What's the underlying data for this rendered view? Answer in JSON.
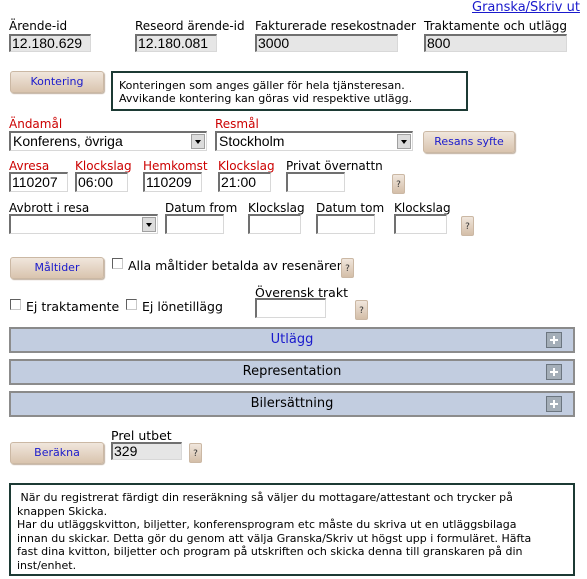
{
  "header": {
    "print_link": "Granska/Skriv ut",
    "fields": [
      {
        "label": "Ärende-id",
        "value": "12.180.629"
      },
      {
        "label": "Reseord ärende-id",
        "value": "12.180.081"
      },
      {
        "label": "Fakturerade resekostnader",
        "value": "3000"
      },
      {
        "label": "Traktamente och utlägg",
        "value": "800"
      }
    ]
  },
  "kontering": {
    "button_label": "Kontering",
    "note_line1": "Konteringen som anges gäller för hela tjänsteresan.",
    "note_line2": "Avvikande kontering kan göras vid respektive utlägg."
  },
  "purpose": {
    "andamal_label": "Ändamål",
    "andamal_value": "Konferens, övriga",
    "resmal_label": "Resmål",
    "resmal_value": "Stockholm",
    "syfte_button": "Resans syfte"
  },
  "dates": {
    "avresa_label": "Avresa",
    "avresa_value": "110207",
    "klockslag1_label": "Klockslag",
    "klockslag1_value": "06:00",
    "hemkomst_label": "Hemkomst",
    "hemkomst_value": "110209",
    "klockslag2_label": "Klockslag",
    "klockslag2_value": "21:00",
    "privat_label": "Privat övernattn",
    "privat_value": ""
  },
  "interruption": {
    "avbrott_label": "Avbrott i resa",
    "avbrott_value": "",
    "datum_from_label": "Datum from",
    "klockslag_from_label": "Klockslag",
    "datum_tom_label": "Datum tom",
    "klockslag_tom_label": "Klockslag"
  },
  "meals": {
    "button_label": "Måltider",
    "all_paid_label": "Alla måltider betalda av resenären",
    "all_paid_checked": false
  },
  "options": {
    "ej_traktamente_label": "Ej traktamente",
    "ej_traktamente_checked": false,
    "ej_lonetillagg_label": "Ej lönetillägg",
    "ej_lonetillagg_checked": false,
    "overensk_label": "Överensk trakt",
    "overensk_value": ""
  },
  "help_label": "?",
  "sections": [
    {
      "label": "Utlägg",
      "color": "#1a1acc"
    },
    {
      "label": "Representation",
      "color": "#000000"
    },
    {
      "label": "Bilersättning",
      "color": "#000000"
    }
  ],
  "calc": {
    "button_label": "Beräkna",
    "prel_label": "Prel utbet",
    "prel_value": "329"
  },
  "footer_note": {
    "line1": " När du registrerat färdigt din reseräkning så väljer du mottagare/attestant och trycker på",
    "line2": "knappen Skicka.",
    "line3": "Har du utläggskvitton, biljetter, konferensprogram etc måste du skriva ut en utläggsbilaga",
    "line4": "innan du skickar. Detta gör du genom att välja Granska/Skriv ut högst upp i formuläret. Häfta",
    "line5": "fast dina kvitton, biljetter och program på utskriften och skicka denna till granskaren på din",
    "line6": "inst/enhet."
  }
}
